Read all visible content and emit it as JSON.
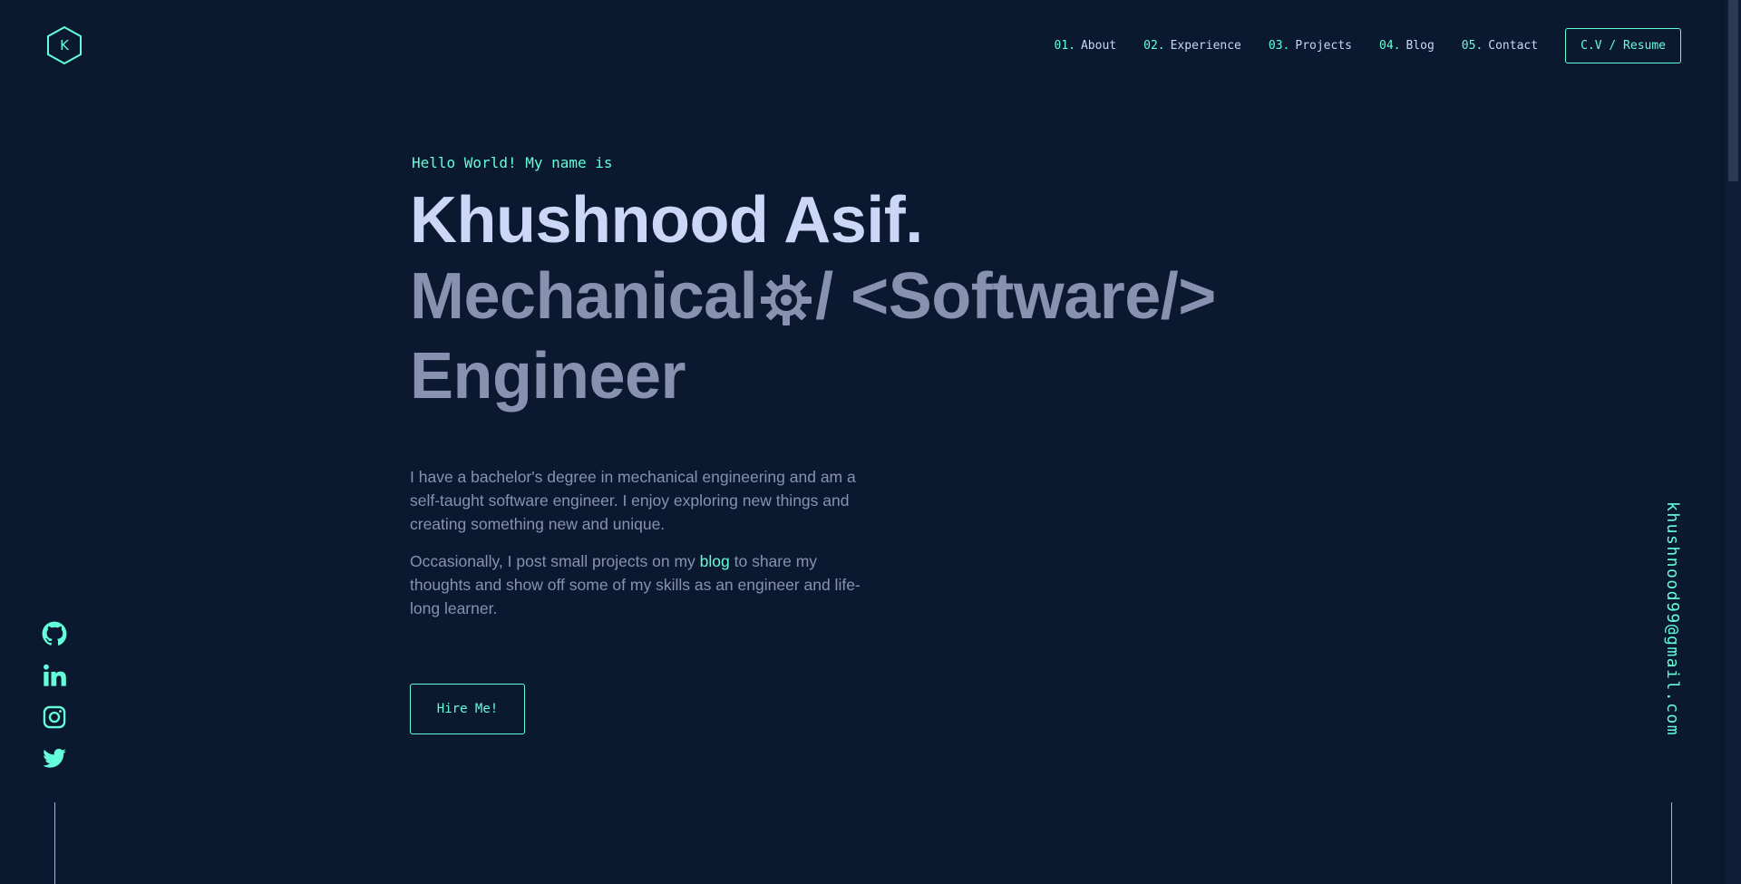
{
  "logo": {
    "letter": "K"
  },
  "nav": {
    "items": [
      {
        "num": "01.",
        "label": "About"
      },
      {
        "num": "02.",
        "label": "Experience"
      },
      {
        "num": "03.",
        "label": "Projects"
      },
      {
        "num": "04.",
        "label": "Blog"
      },
      {
        "num": "05.",
        "label": "Contact"
      }
    ],
    "resume_label": "C.V / Resume"
  },
  "hero": {
    "greeting": "Hello World! My name is",
    "name": "Khushnood Asif.",
    "role_part1": "Mechanical",
    "role_part2": "/ <Software/>",
    "role_line2": "Engineer",
    "bio1": "I have a bachelor's degree in mechanical engineering and am a self-taught software engineer. I enjoy exploring new things and creating something new and unique.",
    "bio2_pre": "Occasionally, I post small projects on my ",
    "bio2_link": "blog",
    "bio2_post": " to share my thoughts and show off some of my skills as an engineer and life-long learner.",
    "hire_label": "Hire Me!"
  },
  "social": [
    "github-icon",
    "linkedin-icon",
    "instagram-icon",
    "twitter-icon"
  ],
  "email": "khushnood99@gmail.com",
  "colors": {
    "background": "#0a192f",
    "accent": "#64ffda",
    "heading": "#ccd6f6",
    "text": "#8892b0"
  }
}
